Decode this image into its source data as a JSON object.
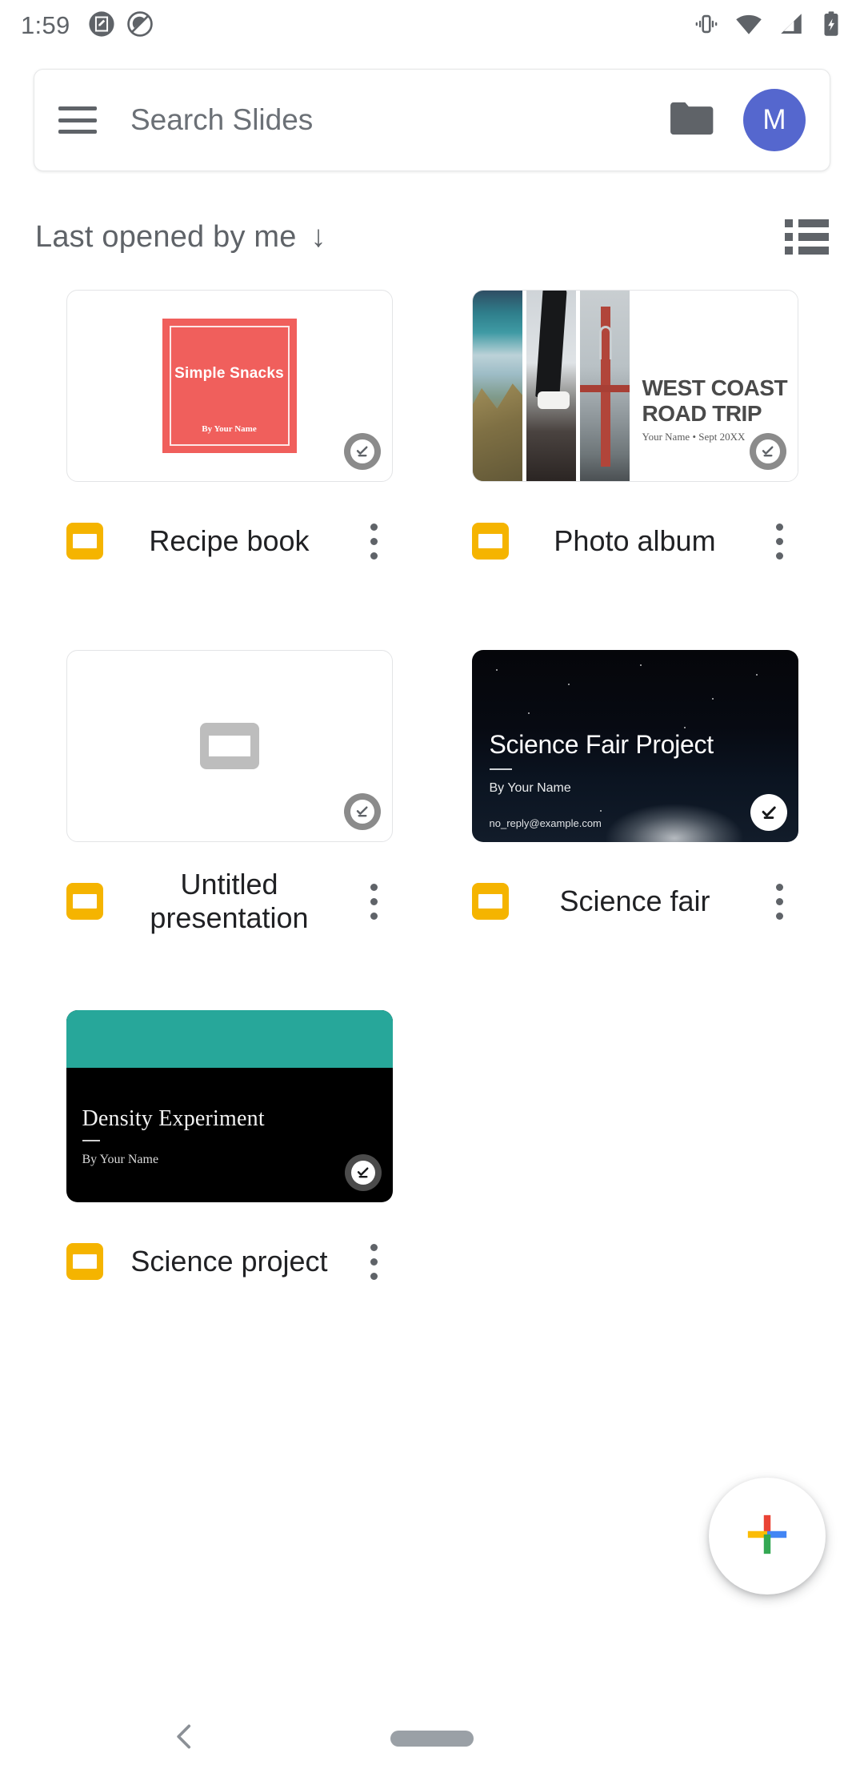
{
  "status_bar": {
    "time": "1:59",
    "notification_icons": [
      "screenshot-markup-icon",
      "do-not-disturb-icon"
    ],
    "system_icons": [
      "vibrate-icon",
      "wifi-icon",
      "cellular-signal-icon",
      "battery-charging-icon"
    ]
  },
  "search": {
    "placeholder": "Search Slides",
    "menu_icon": "hamburger-menu-icon",
    "folder_icon": "folder-icon",
    "avatar_letter": "M",
    "avatar_color": "#5567ce"
  },
  "sort": {
    "label": "Last opened by me",
    "direction_arrow": "↓",
    "view_toggle_icon": "list-view-icon"
  },
  "files": [
    {
      "title": "Recipe book",
      "app_icon": "google-slides-icon",
      "overflow_icon": "more-options-icon",
      "badge": "available-offline-icon",
      "thumb": {
        "kind": "recipe",
        "slide_title": "Simple Snacks",
        "slide_byline": "By Your Name",
        "accent": "#f05f5c"
      }
    },
    {
      "title": "Photo album",
      "app_icon": "google-slides-icon",
      "overflow_icon": "more-options-icon",
      "badge": "available-offline-icon",
      "thumb": {
        "kind": "photo-album",
        "slide_title_line1": "WEST COAST",
        "slide_title_line2": "ROAD TRIP",
        "slide_byline": "Your Name • Sept 20XX"
      }
    },
    {
      "title": "Untitled presentation",
      "app_icon": "google-slides-icon",
      "overflow_icon": "more-options-icon",
      "badge": "available-offline-icon",
      "thumb": {
        "kind": "placeholder"
      }
    },
    {
      "title": "Science fair",
      "app_icon": "google-slides-icon",
      "overflow_icon": "more-options-icon",
      "badge": "available-offline-icon",
      "thumb": {
        "kind": "night-sky",
        "slide_title": "Science Fair Project",
        "slide_byline": "By Your Name",
        "slide_email": "no_reply@example.com"
      }
    },
    {
      "title": "Science project",
      "app_icon": "google-slides-icon",
      "overflow_icon": "more-options-icon",
      "badge": "available-offline-icon",
      "thumb": {
        "kind": "teal-black",
        "slide_title": "Density Experiment",
        "slide_byline": "By Your Name",
        "accent": "#27a79a"
      }
    }
  ],
  "fab": {
    "icon": "plus-icon",
    "colors": {
      "red": "#ea4335",
      "yellow": "#fbbc04",
      "blue": "#4285f4",
      "green": "#34a853"
    }
  },
  "nav_bar": {
    "back_icon": "back-chevron-icon",
    "home_icon": "home-pill-icon"
  }
}
